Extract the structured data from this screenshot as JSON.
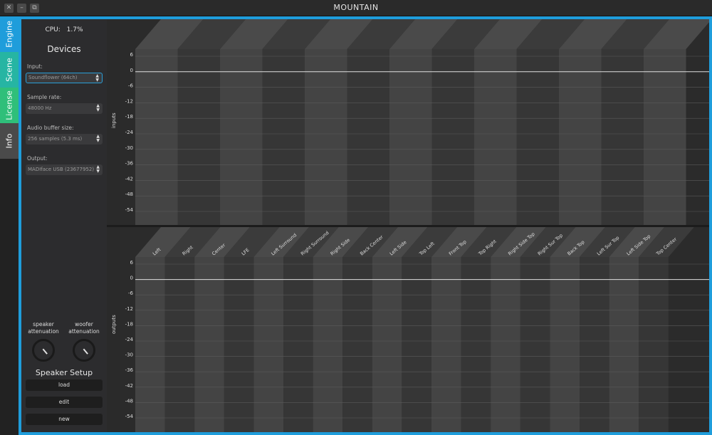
{
  "window": {
    "title": "MOUNTAIN"
  },
  "tabs": [
    {
      "label": "Engine",
      "color": "#1f9ddb"
    },
    {
      "label": "Scene",
      "color": "#26b5a3"
    },
    {
      "label": "License",
      "color": "#2fbf7a"
    },
    {
      "label": "Info",
      "color": "#4a4a4a"
    }
  ],
  "sidebar": {
    "cpu_label": "CPU:",
    "cpu_value": "1.7%",
    "devices_title": "Devices",
    "input_label": "Input:",
    "input_value": "Soundflower (64ch)",
    "sample_rate_label": "Sample rate:",
    "sample_rate_value": "48000 Hz",
    "buffer_label": "Audio buffer size:",
    "buffer_value": "256 samples (5.3 ms)",
    "output_label": "Output:",
    "output_value": "MADIface USB (23677952)",
    "speaker_att_label_1": "speaker",
    "speaker_att_label_2": "attenuation",
    "woofer_att_label_1": "woofer",
    "woofer_att_label_2": "attenuation",
    "speaker_setup_title": "Speaker Setup",
    "load_label": "load",
    "edit_label": "edit",
    "new_label": "new"
  },
  "inputs_panel": {
    "axis_title": "inputs",
    "scale": [
      "6",
      "0",
      "-6",
      "-12",
      "-18",
      "-24",
      "-30",
      "-36",
      "-42",
      "-48",
      "-54"
    ],
    "channel_count": 13
  },
  "outputs_panel": {
    "axis_title": "outputs",
    "scale": [
      "6",
      "0",
      "-6",
      "-12",
      "-18",
      "-24",
      "-30",
      "-36",
      "-42",
      "-48",
      "-54"
    ],
    "channels": [
      "Left",
      "Right",
      "Center",
      "LFE",
      "Left Surround",
      "Right Surround",
      "Right Side",
      "Back Center",
      "Left Side",
      "Top Left",
      "Front Top",
      "Top Right",
      "Right Side Top",
      "Right Sur Top",
      "Back Top",
      "Left Sur Top",
      "Left Side Top",
      "Top Center"
    ]
  }
}
